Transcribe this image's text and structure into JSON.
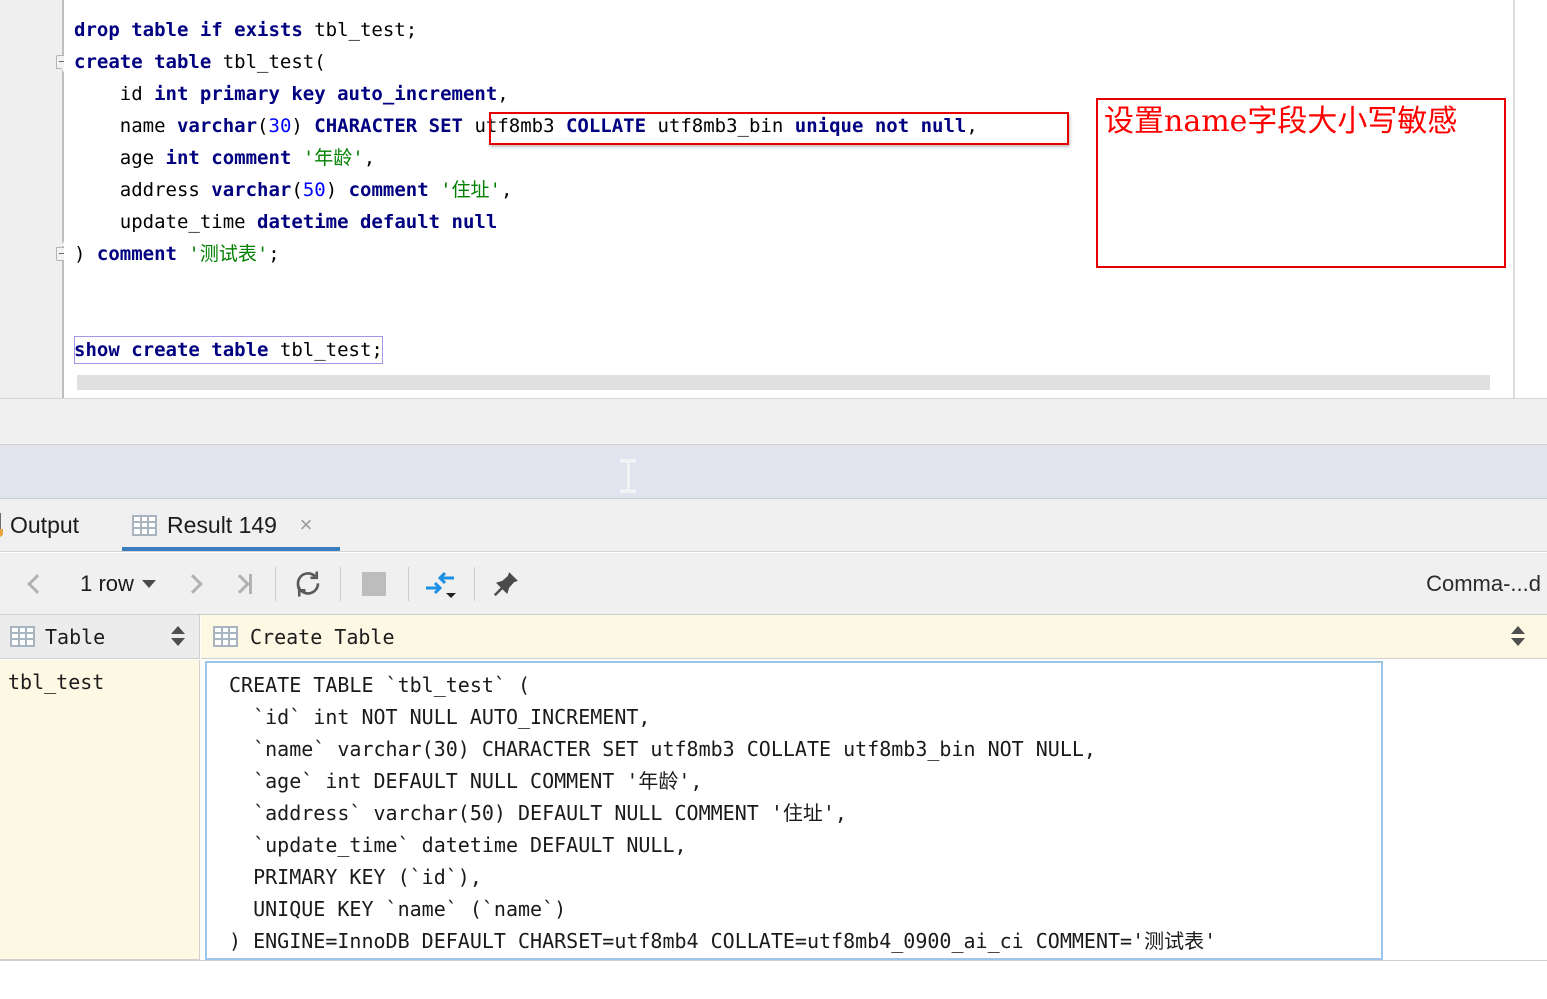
{
  "editor": {
    "lines": [
      [
        {
          "t": "drop table if exists ",
          "c": "kw"
        },
        {
          "t": "tbl_test;",
          "c": "pln"
        }
      ],
      [
        {
          "t": "create table ",
          "c": "kw"
        },
        {
          "t": "tbl_test(",
          "c": "pln"
        }
      ],
      [
        {
          "t": "    ",
          "c": "pln"
        },
        {
          "t": "id ",
          "c": "pln"
        },
        {
          "t": "int primary key auto_increment",
          "c": "kw"
        },
        {
          "t": ",",
          "c": "pln"
        }
      ],
      [
        {
          "t": "    ",
          "c": "pln"
        },
        {
          "t": "name ",
          "c": "pln"
        },
        {
          "t": "varchar",
          "c": "kw"
        },
        {
          "t": "(",
          "c": "pln"
        },
        {
          "t": "30",
          "c": "num"
        },
        {
          "t": ") ",
          "c": "pln"
        },
        {
          "t": "CHARACTER SET ",
          "c": "kw"
        },
        {
          "t": "utf8mb3 ",
          "c": "pln"
        },
        {
          "t": "COLLATE ",
          "c": "kw"
        },
        {
          "t": "utf8mb3_bin ",
          "c": "pln"
        },
        {
          "t": "unique not null",
          "c": "kw"
        },
        {
          "t": ",",
          "c": "pln"
        }
      ],
      [
        {
          "t": "    ",
          "c": "pln"
        },
        {
          "t": "age ",
          "c": "pln"
        },
        {
          "t": "int comment ",
          "c": "kw"
        },
        {
          "t": "'年龄'",
          "c": "str"
        },
        {
          "t": ",",
          "c": "pln"
        }
      ],
      [
        {
          "t": "    ",
          "c": "pln"
        },
        {
          "t": "address ",
          "c": "pln"
        },
        {
          "t": "varchar",
          "c": "kw"
        },
        {
          "t": "(",
          "c": "pln"
        },
        {
          "t": "50",
          "c": "num"
        },
        {
          "t": ") ",
          "c": "pln"
        },
        {
          "t": "comment ",
          "c": "kw"
        },
        {
          "t": "'住址'",
          "c": "str"
        },
        {
          "t": ",",
          "c": "pln"
        }
      ],
      [
        {
          "t": "    ",
          "c": "pln"
        },
        {
          "t": "update_time ",
          "c": "pln"
        },
        {
          "t": "datetime default null",
          "c": "kw"
        }
      ],
      [
        {
          "t": ") ",
          "c": "pln"
        },
        {
          "t": "comment ",
          "c": "kw"
        },
        {
          "t": "'测试表'",
          "c": "str"
        },
        {
          "t": ";",
          "c": "pln"
        }
      ],
      [],
      [
        {
          "t": "show create table ",
          "c": "kw"
        },
        {
          "t": "tbl_test",
          "c": "pln"
        },
        {
          "t": ";",
          "c": "pln"
        }
      ]
    ],
    "annotation_note": "设置name字段大小写敏感",
    "fold_open_marker": "-",
    "fold_close_marker": "-",
    "highlight_colors": {
      "annotation_red": "#ff0000",
      "keyword_navy": "#000080",
      "string_green": "#008000",
      "number_blue": "#0000ff",
      "current_line_yellow": "#fdf8e3",
      "caret_box_purple": "#a396e8"
    }
  },
  "tabs": {
    "output": {
      "label": "Output",
      "icon": "output-panel-icon"
    },
    "result": {
      "label": "Result 149",
      "icon": "grid-icon",
      "close": "×",
      "active": true
    }
  },
  "toolbar": {
    "prev_label": "",
    "row_count": "1 row",
    "next_label": "",
    "last_label": "",
    "refresh_icon": "refresh-icon",
    "stop_icon": "stop-icon",
    "transpose_icon": "transpose-icon",
    "pin_icon": "pin-icon",
    "format_label": "Comma-...d"
  },
  "grid": {
    "columns": [
      {
        "name": "Table",
        "icon": "grid-column-icon"
      },
      {
        "name": "Create Table",
        "icon": "grid-column-icon"
      }
    ],
    "row": {
      "table": "tbl_test",
      "create_table_lines": [
        "CREATE TABLE `tbl_test` (",
        "  `id` int NOT NULL AUTO_INCREMENT,",
        "  `name` varchar(30) CHARACTER SET utf8mb3 COLLATE utf8mb3_bin NOT NULL,",
        "  `age` int DEFAULT NULL COMMENT '年龄',",
        "  `address` varchar(50) DEFAULT NULL COMMENT '住址',",
        "  `update_time` datetime DEFAULT NULL,",
        "  PRIMARY KEY (`id`),",
        "  UNIQUE KEY `name` (`name`)",
        ") ENGINE=InnoDB DEFAULT CHARSET=utf8mb4 COLLATE=utf8mb4_0900_ai_ci COMMENT='测试表'"
      ]
    }
  }
}
